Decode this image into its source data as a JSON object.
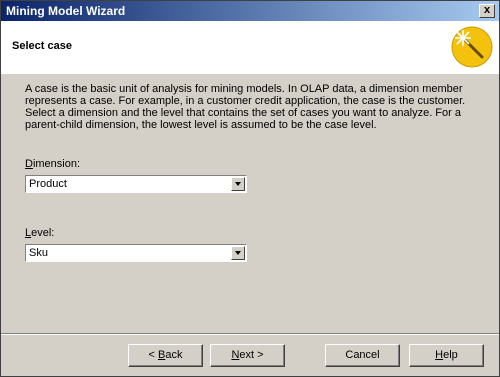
{
  "window": {
    "title": "Mining Model Wizard",
    "close_label": "x"
  },
  "header": {
    "heading": "Select case",
    "icon": "magic-wand-icon",
    "icon_color": "#f4c20d"
  },
  "description": "A case is the basic unit of analysis for mining models. In OLAP data, a dimension member represents a case. For example, in a customer credit application, the case is the customer. Select a dimension and the level that contains the set of cases you want to analyze. For a parent-child dimension, the lowest level is assumed to be the case level.",
  "dimension": {
    "label_first": "D",
    "label_rest": "imension:",
    "value": "Product"
  },
  "level": {
    "label_first": "L",
    "label_rest": "evel:",
    "value": "Sku"
  },
  "buttons": {
    "back_pre": "< ",
    "back_u": "B",
    "back_post": "ack",
    "next_pre": "",
    "next_u": "N",
    "next_post": "ext >",
    "cancel": "Cancel",
    "help_pre": "",
    "help_u": "H",
    "help_post": "elp"
  }
}
